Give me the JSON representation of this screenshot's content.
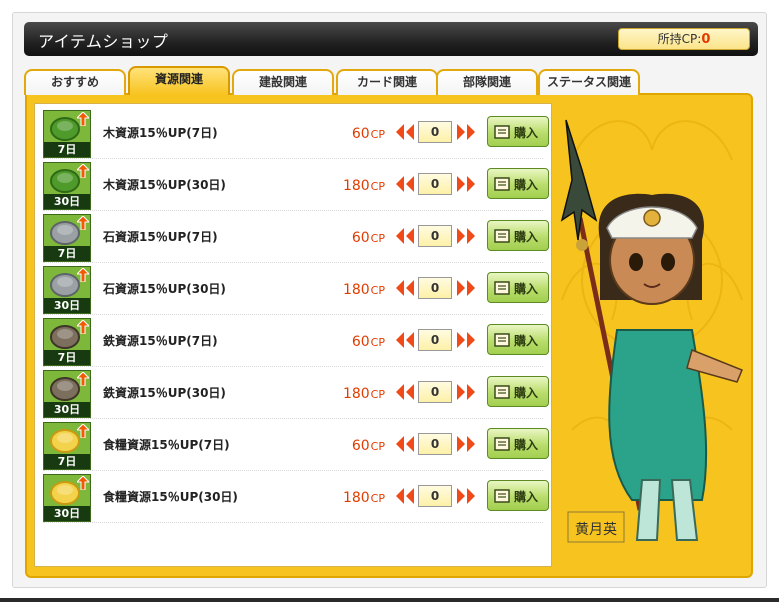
{
  "header": {
    "title": "アイテムショップ",
    "cp_label": "所持CP:",
    "cp_value": "0"
  },
  "tabs": [
    {
      "label": "おすすめ",
      "active": false
    },
    {
      "label": "資源関連",
      "active": true
    },
    {
      "label": "建設関連",
      "active": false
    },
    {
      "label": "カード関連",
      "active": false
    },
    {
      "label": "部隊関連",
      "active": false
    },
    {
      "label": "ステータス関連",
      "active": false
    }
  ],
  "items": [
    {
      "name": "木資源15％UP(7日)",
      "duration": "7日",
      "price": "60",
      "unit": "CP",
      "qty": "0",
      "buy_label": "購入",
      "icon": "wood-resource-icon"
    },
    {
      "name": "木資源15％UP(30日)",
      "duration": "30日",
      "price": "180",
      "unit": "CP",
      "qty": "0",
      "buy_label": "購入",
      "icon": "wood-resource-icon"
    },
    {
      "name": "石資源15％UP(7日)",
      "duration": "7日",
      "price": "60",
      "unit": "CP",
      "qty": "0",
      "buy_label": "購入",
      "icon": "stone-resource-icon"
    },
    {
      "name": "石資源15％UP(30日)",
      "duration": "30日",
      "price": "180",
      "unit": "CP",
      "qty": "0",
      "buy_label": "購入",
      "icon": "stone-resource-icon"
    },
    {
      "name": "鉄資源15％UP(7日)",
      "duration": "7日",
      "price": "60",
      "unit": "CP",
      "qty": "0",
      "buy_label": "購入",
      "icon": "iron-resource-icon"
    },
    {
      "name": "鉄資源15％UP(30日)",
      "duration": "30日",
      "price": "180",
      "unit": "CP",
      "qty": "0",
      "buy_label": "購入",
      "icon": "iron-resource-icon"
    },
    {
      "name": "食糧資源15％UP(7日)",
      "duration": "7日",
      "price": "60",
      "unit": "CP",
      "qty": "0",
      "buy_label": "購入",
      "icon": "food-resource-icon"
    },
    {
      "name": "食糧資源15％UP(30日)",
      "duration": "30日",
      "price": "180",
      "unit": "CP",
      "qty": "0",
      "buy_label": "購入",
      "icon": "food-resource-icon"
    }
  ],
  "character": {
    "signature": "黄月英"
  },
  "colors": {
    "accent": "#f7c41f",
    "price": "#e23b00",
    "buy_button": "#b9dd6c",
    "title_bar": "#222222"
  }
}
